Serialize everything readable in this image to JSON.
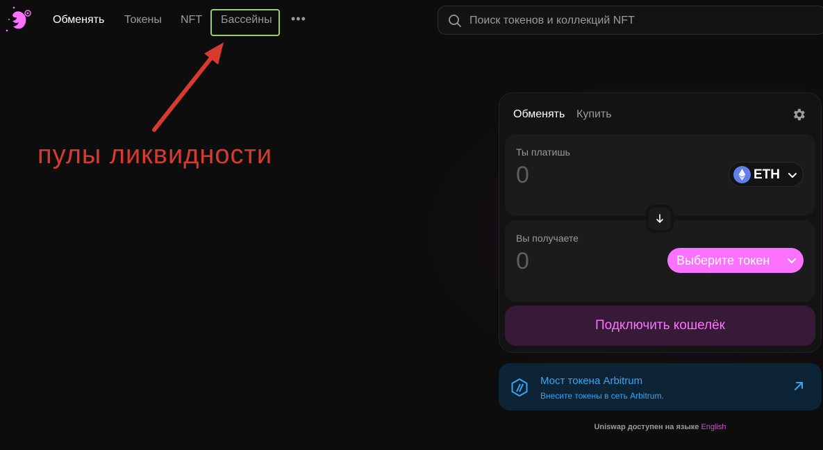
{
  "nav": {
    "items": [
      {
        "label": "Обменять",
        "active": true
      },
      {
        "label": "Токены",
        "active": false
      },
      {
        "label": "NFT",
        "active": false
      },
      {
        "label": "Бассейны",
        "active": false
      }
    ],
    "more": "•••"
  },
  "search": {
    "placeholder": "Поиск токенов и коллекций NFT",
    "icon": "search-icon"
  },
  "annotation": {
    "text": "пулы ликвидности",
    "color": "#d93a2e",
    "highlight_color": "#9fd05b"
  },
  "swap": {
    "tabs": [
      "Обменять",
      "Купить"
    ],
    "pay": {
      "label": "Ты платишь",
      "amount": "0",
      "token": "ETH"
    },
    "receive": {
      "label": "Вы получаете",
      "amount": "0",
      "select_label": "Выберите токен"
    },
    "connect_label": "Подключить кошелёк"
  },
  "banner": {
    "title": "Мост токена Arbitrum",
    "subtitle": "Внесите токены в сеть Arbitrum."
  },
  "footer": {
    "lang_prefix": "Uniswap доступен на языке",
    "lang_link": "English"
  },
  "colors": {
    "accent": "#fc72ff",
    "background": "#0d0d0d",
    "card": "#131313",
    "panel": "#1b1b1b",
    "arbitrum_blue": "#3ba4f0"
  }
}
